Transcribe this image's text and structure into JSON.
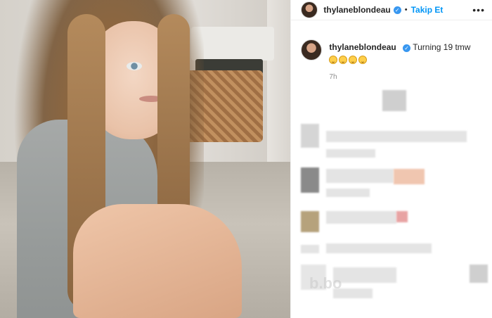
{
  "post": {
    "author": {
      "username": "thylaneblondeau",
      "verified": true,
      "follow_label": "Takip Et",
      "separator": "•"
    },
    "caption": {
      "username": "thylaneblondeau",
      "text": "Turning 19 tmw",
      "emojis": [
        "grinning-face-emoji",
        "grinning-face-emoji",
        "sad-face-emoji",
        "sad-face-emoji"
      ]
    },
    "timestamp": "7h",
    "more_icon": "more-options-icon",
    "watermark": "b.bo"
  },
  "colors": {
    "link": "#0095f6",
    "verified": "#3897f0",
    "text": "#262626",
    "muted": "#8e8e8e"
  }
}
